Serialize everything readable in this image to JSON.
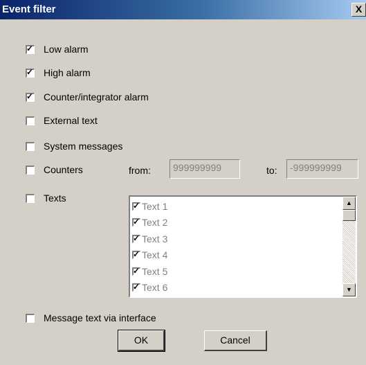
{
  "window": {
    "title": "Event filter",
    "close_glyph": "X"
  },
  "options": {
    "low_alarm": {
      "label": "Low alarm",
      "checked": true
    },
    "high_alarm": {
      "label": "High alarm",
      "checked": true
    },
    "counter_alarm": {
      "label": "Counter/integrator alarm",
      "checked": true
    },
    "external_text": {
      "label": "External text",
      "checked": false
    },
    "system_messages": {
      "label": "System messages",
      "checked": false
    },
    "counters": {
      "label": "Counters",
      "checked": false
    },
    "texts": {
      "label": "Texts",
      "checked": false
    },
    "message_text": {
      "label": "Message text via interface",
      "checked": false
    }
  },
  "counters_range": {
    "from_label": "from:",
    "from_value": "999999999",
    "to_label": "to:",
    "to_value": "-999999999"
  },
  "texts_list": [
    {
      "label": "Text 1",
      "checked": true
    },
    {
      "label": "Text 2",
      "checked": true
    },
    {
      "label": "Text 3",
      "checked": true
    },
    {
      "label": "Text 4",
      "checked": true
    },
    {
      "label": "Text 5",
      "checked": true
    },
    {
      "label": "Text 6",
      "checked": true
    }
  ],
  "scrollbar": {
    "up_glyph": "▲",
    "down_glyph": "▼"
  },
  "buttons": {
    "ok": "OK",
    "cancel": "Cancel"
  }
}
